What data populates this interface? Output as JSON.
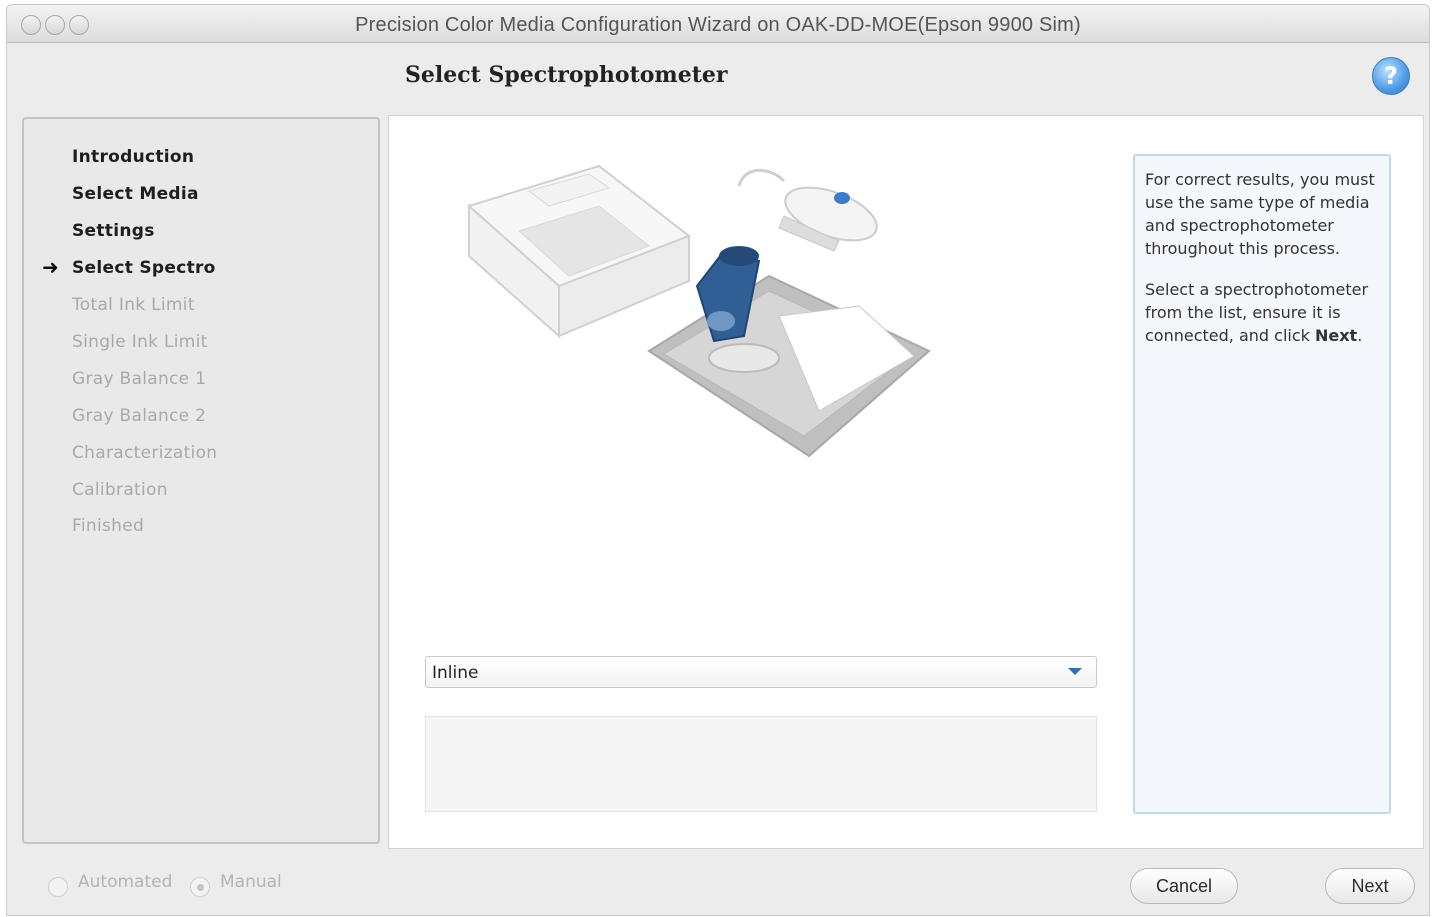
{
  "window": {
    "title": "Precision Color Media Configuration Wizard on OAK-DD-MOE(Epson 9900 Sim)"
  },
  "header": {
    "title": "Select Spectrophotometer",
    "help_icon": "help-question-icon",
    "help_glyph": "?"
  },
  "sidebar": {
    "current_marker": "➜",
    "steps": [
      {
        "label": "Introduction",
        "state": "done"
      },
      {
        "label": "Select Media",
        "state": "done"
      },
      {
        "label": "Settings",
        "state": "done"
      },
      {
        "label": "Select Spectro",
        "state": "current"
      },
      {
        "label": "Total Ink Limit",
        "state": "future"
      },
      {
        "label": "Single Ink Limit",
        "state": "future"
      },
      {
        "label": "Gray Balance 1",
        "state": "future"
      },
      {
        "label": "Gray Balance 2",
        "state": "future"
      },
      {
        "label": "Characterization",
        "state": "future"
      },
      {
        "label": "Calibration",
        "state": "future"
      },
      {
        "label": "Finished",
        "state": "future"
      }
    ]
  },
  "main": {
    "spectro_select": {
      "value": "Inline",
      "arrow_icon": "chevron-down-icon"
    },
    "info_panel": {
      "paragraph1": "For correct results, you must use the same type of media and spectrophotometer throughout this process.",
      "paragraph2_prefix": "Select a spectrophotometer from the list, ensure it is connected, and click ",
      "paragraph2_bold": "Next",
      "paragraph2_suffix": "."
    }
  },
  "footer": {
    "mode_automated": "Automated",
    "mode_manual": "Manual",
    "selected_mode": "Manual",
    "cancel_label": "Cancel",
    "next_label": "Next"
  }
}
